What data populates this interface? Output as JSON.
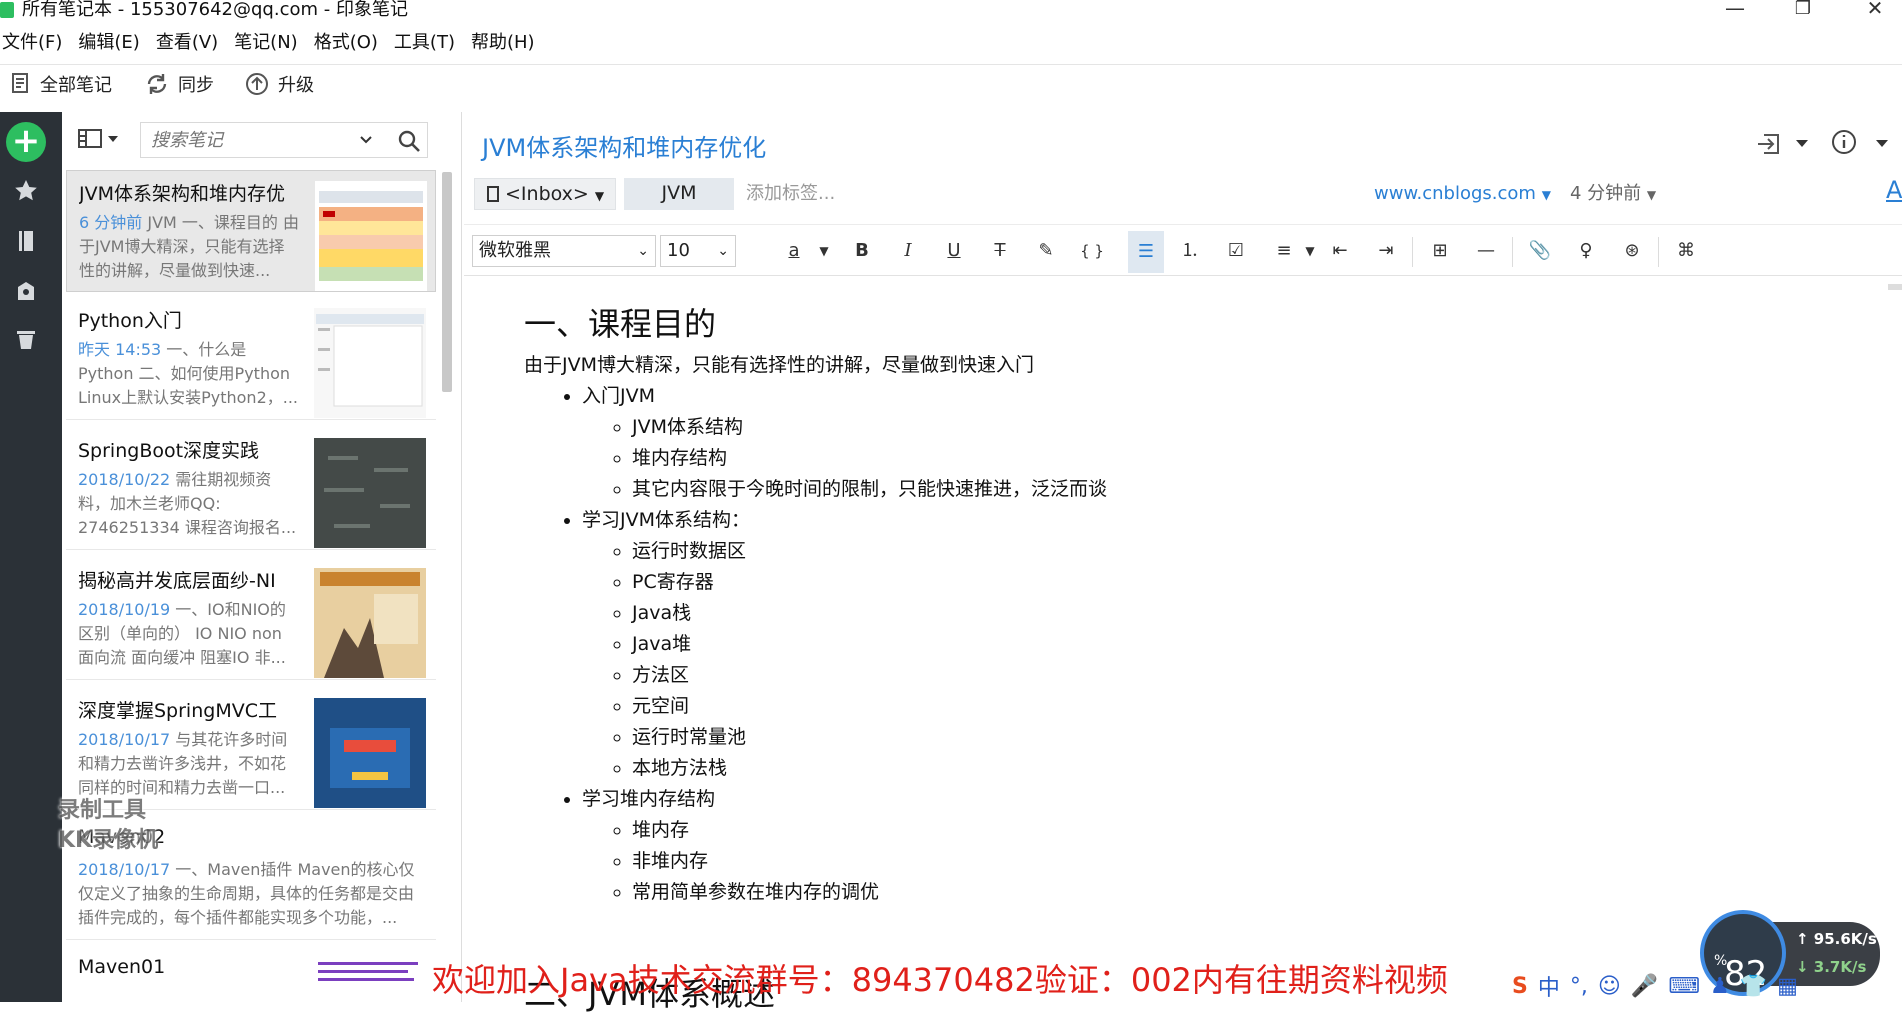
{
  "window": {
    "title": "所有笔记本 - 155307642@qq.com - 印象笔记"
  },
  "menu": [
    "文件(F)",
    "编辑(E)",
    "查看(V)",
    "笔记(N)",
    "格式(O)",
    "工具(T)",
    "帮助(H)"
  ],
  "toolbar": {
    "all_notes": "全部笔记",
    "sync": "同步",
    "upgrade": "升级"
  },
  "search": {
    "placeholder": "搜索笔记"
  },
  "notes": [
    {
      "title": "JVM体系架构和堆内存优",
      "date": "6 分钟前",
      "snippet": " JVM 一、课程目的 由于JVM博大精深，只能有选择性的讲解，尽量做到快速..."
    },
    {
      "title": "Python入门",
      "date": "昨天 14:53",
      "snippet": " 一、什么是 Python 二、如何使用Python Linux上默认安装Python2，..."
    },
    {
      "title": "SpringBoot深度实践",
      "date": "2018/10/22",
      "snippet": " 需往期视频资料，加木兰老师QQ: 2746251334 课程咨询报名..."
    },
    {
      "title": "揭秘高并发底层面纱-NI",
      "date": "2018/10/19",
      "snippet": " 一、IO和NIO的区别（单向的） IO NIO non 面向流 面向缓冲 阻塞IO 非..."
    },
    {
      "title": "深度掌握SpringMVC工",
      "date": "2018/10/17",
      "snippet": " 与其花许多时间和精力去凿许多浅井，不如花同样的时间和精力去凿一口..."
    },
    {
      "title": "Maven02",
      "date": "2018/10/17",
      "snippet": " 一、Maven插件 Maven的核心仅仅定义了抽象的生命周期，具体的任务都是交由插件完成的，每个插件都能实现多个功能，..."
    },
    {
      "title": "Maven01",
      "date": "",
      "snippet": ""
    }
  ],
  "editor": {
    "title": "JVM体系架构和堆内存优化",
    "notebook": "<Inbox>",
    "tag": "JVM",
    "add_tag": "添加标签...",
    "source_url": "www.cnblogs.com",
    "time": "4 分钟前",
    "font_family": "微软雅黑",
    "font_size": "10"
  },
  "content": {
    "h1": "一、课程目的",
    "intro": "由于JVM博大精深，只能有选择性的讲解，尽量做到快速入门",
    "items": [
      {
        "text": "入门JVM",
        "sub": [
          "JVM体系结构",
          "堆内存结构",
          "其它内容限于今晚时间的限制，只能快速推进，泛泛而谈"
        ]
      },
      {
        "text": "学习JVM体系结构：",
        "sub": [
          "运行时数据区",
          "PC寄存器",
          "Java栈",
          "Java堆",
          "方法区",
          "元空间",
          "运行时常量池",
          "本地方法栈"
        ]
      },
      {
        "text": "学习堆内存结构",
        "sub": [
          "堆内存",
          "非堆内存",
          "常用简单参数在堆内存的调优"
        ]
      }
    ],
    "next_heading": "二、JVM体系概述"
  },
  "overlay": {
    "watermark_line1": "录制工具",
    "watermark_line2": "KK录像机",
    "banner": "欢迎加入Java技术交流群号：894370482验证：002内有往期资料视频",
    "speed_percent": "82",
    "speed_unit": "%",
    "upload": "95.6K/s",
    "download": "3.7K/s",
    "ime": "中"
  },
  "colors": {
    "accent_green": "#2dbe60",
    "link_blue": "#2a7fd4",
    "sidebar": "#2b3137",
    "banner_red": "#e0201a"
  }
}
